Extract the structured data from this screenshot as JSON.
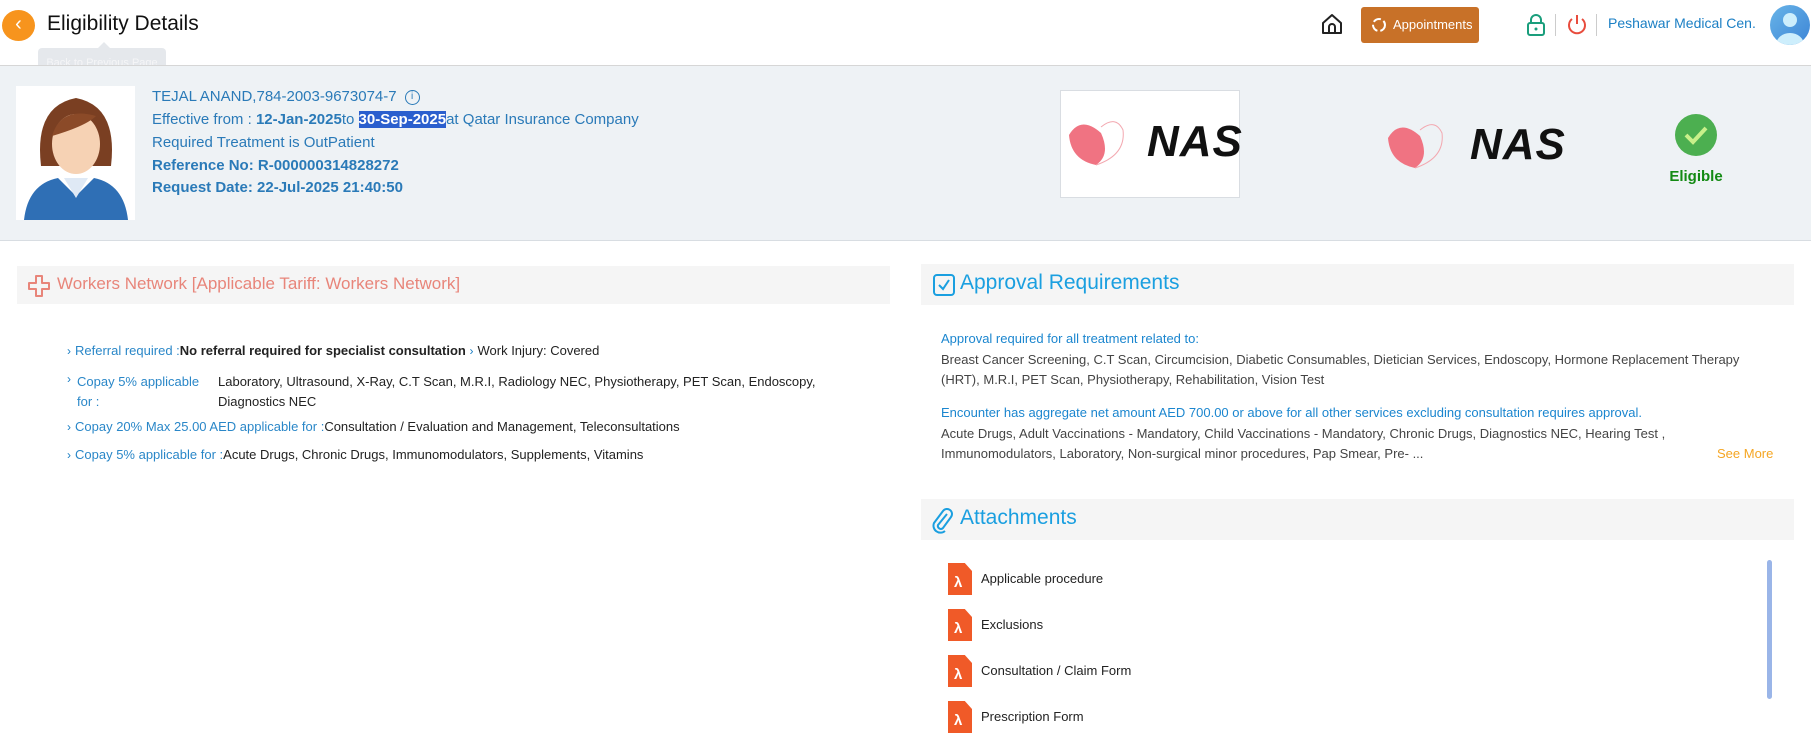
{
  "header": {
    "title": "Eligibility Details",
    "back_tooltip": "Back to Previous Page",
    "appointments_label": "Appointments (0)",
    "facility": "Peshawar Medical Cen..."
  },
  "patient": {
    "name_id": "TEJAL ANAND,784-2003-9673074-7",
    "effective_prefix": "Effective from : ",
    "effective_from": "12-Jan-2025",
    "to_word": "to ",
    "effective_to": "30-Sep-2025",
    "insurer": "at Qatar Insurance Company",
    "treatment": "Required Treatment is OutPatient",
    "reference": "Reference No: R-000000314828272",
    "request_date": "Request Date: 22-Jul-2025 21:40:50"
  },
  "payer_logo": "NAS",
  "tpa_logo": "NAS",
  "status": {
    "label": "Eligible",
    "color": "#4caf50"
  },
  "network": {
    "title": "Workers Network [Applicable Tariff: Workers Network]",
    "items": [
      {
        "label": "Referral required :",
        "value": "No referral required for specialist consultation",
        "extra": "Work Injury: Covered"
      },
      {
        "label": "Copay 5% applicable for :",
        "value": "Laboratory, Ultrasound, X-Ray, C.T Scan, M.R.I, Radiology NEC, Physiotherapy, PET Scan, Endoscopy, Diagnostics NEC"
      },
      {
        "label": "Copay 20% Max 25.00 AED applicable for :",
        "value": "Consultation / Evaluation and Management, Teleconsultations"
      },
      {
        "label": "Copay 5% applicable for :",
        "value": "Acute Drugs, Chronic Drugs, Immunomodulators, Supplements, Vitamins"
      }
    ]
  },
  "approval": {
    "title": "Approval Requirements",
    "heading1": "Approval required for all treatment related to:",
    "list1_line1": "Breast Cancer Screening, C.T Scan, Circumcision, Diabetic Consumables, Dietician Services, Endoscopy, Hormone Replacement Therapy",
    "list1_line2": "(HRT), M.R.I, PET Scan, Physiotherapy, Rehabilitation, Vision Test",
    "heading2": "Encounter has aggregate net amount AED 700.00 or above for all other services excluding consultation requires approval.",
    "list2_line1": "Acute Drugs, Adult Vaccinations - Mandatory, Child Vaccinations - Mandatory, Chronic Drugs, Diagnostics NEC, Hearing Test ,",
    "list2_line2": "Immunomodulators, Laboratory, Non-surgical minor procedures, Pap Smear, Pre- ...",
    "see_more": "See More"
  },
  "attachments": {
    "title": "Attachments",
    "items": [
      "Applicable procedure",
      "Exclusions",
      "Consultation / Claim Form",
      "Prescription Form"
    ]
  }
}
